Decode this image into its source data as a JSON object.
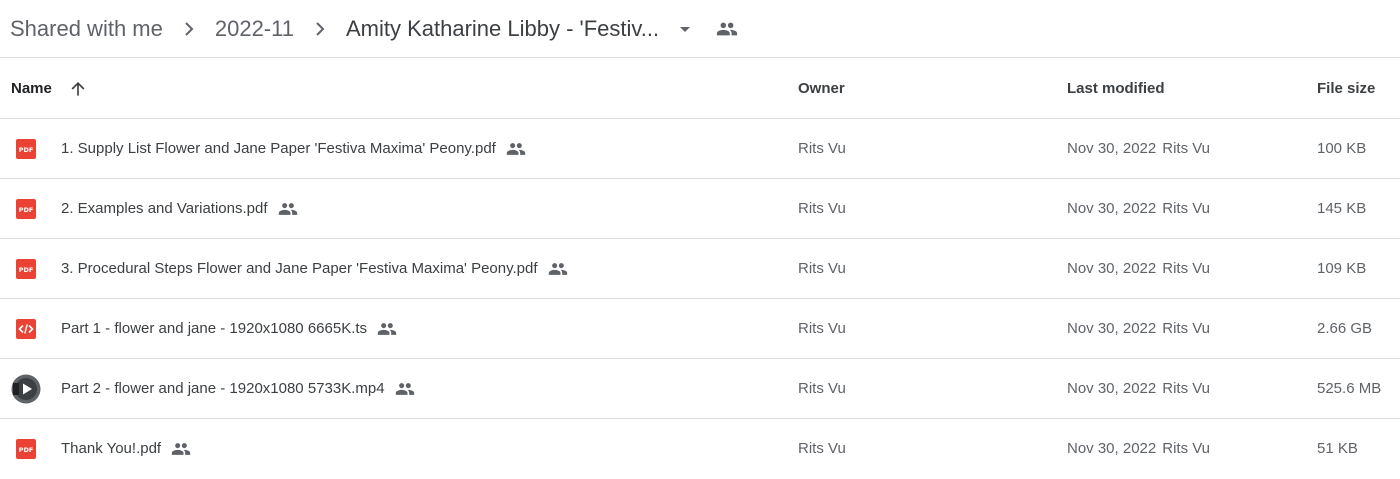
{
  "breadcrumb": {
    "items": [
      "Shared with me",
      "2022-11"
    ],
    "current": "Amity Katharine Libby - 'Festiv..."
  },
  "columns": {
    "name": "Name",
    "owner": "Owner",
    "last_modified": "Last modified",
    "file_size": "File size"
  },
  "files": [
    {
      "name": "1. Supply List Flower and Jane Paper 'Festiva Maxima' Peony.pdf",
      "type": "pdf-icon",
      "owner": "Rits Vu",
      "modified_date": "Nov 30, 2022",
      "modified_by": "Rits Vu",
      "size": "100 KB"
    },
    {
      "name": "2. Examples and Variations.pdf",
      "type": "pdf-icon",
      "owner": "Rits Vu",
      "modified_date": "Nov 30, 2022",
      "modified_by": "Rits Vu",
      "size": "145 KB"
    },
    {
      "name": "3. Procedural Steps Flower and Jane Paper 'Festiva Maxima' Peony.pdf",
      "type": "pdf-icon",
      "owner": "Rits Vu",
      "modified_date": "Nov 30, 2022",
      "modified_by": "Rits Vu",
      "size": "109 KB"
    },
    {
      "name": "Part 1 - flower and jane - 1920x1080 6665K.ts",
      "type": "code-icon",
      "owner": "Rits Vu",
      "modified_date": "Nov 30, 2022",
      "modified_by": "Rits Vu",
      "size": "2.66 GB"
    },
    {
      "name": "Part 2 - flower and jane - 1920x1080 5733K.mp4",
      "type": "video-icon",
      "owner": "Rits Vu",
      "modified_date": "Nov 30, 2022",
      "modified_by": "Rits Vu",
      "size": "525.6 MB"
    },
    {
      "name": "Thank You!.pdf",
      "type": "pdf-icon",
      "owner": "Rits Vu",
      "modified_date": "Nov 30, 2022",
      "modified_by": "Rits Vu",
      "size": "51 KB"
    }
  ],
  "colors": {
    "pdf_red": "#ea4335",
    "icon_gray": "#5f6368",
    "divider": "#dadce0"
  }
}
